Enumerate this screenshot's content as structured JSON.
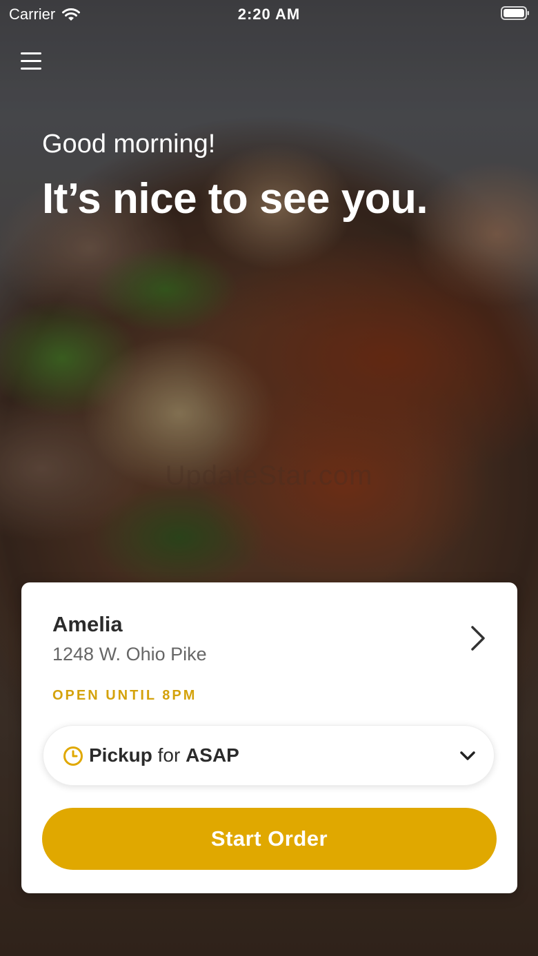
{
  "status_bar": {
    "carrier": "Carrier",
    "time": "2:20 AM"
  },
  "greeting": {
    "small": "Good morning!",
    "big": "It’s nice to see you."
  },
  "watermark": "UpdateStar.com",
  "store": {
    "name": "Amelia",
    "address": "1248 W. Ohio Pike",
    "hours": "OPEN UNTIL 8PM"
  },
  "pickup": {
    "mode": "Pickup",
    "connector": "for",
    "time": "ASAP"
  },
  "actions": {
    "start_order": "Start Order"
  },
  "colors": {
    "accent": "#e0a800",
    "hours_text": "#d4a20b"
  },
  "icons": {
    "menu": "hamburger-menu-icon",
    "wifi": "wifi-icon",
    "battery": "battery-icon",
    "store_chevron": "chevron-right-icon",
    "pickup_clock": "clock-icon",
    "pickup_dropdown": "chevron-down-icon"
  }
}
